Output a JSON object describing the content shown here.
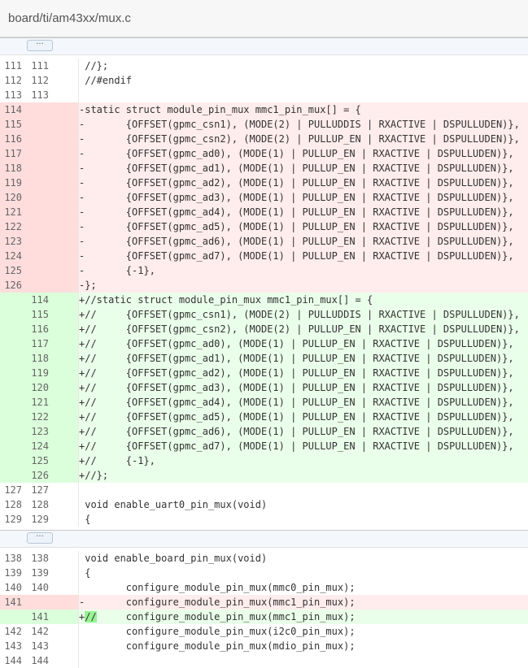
{
  "file": {
    "path": "board/ti/am43xx/mux.c"
  },
  "expander": {
    "label": "···"
  },
  "hunks": [
    [
      {
        "t": "ctx",
        "o": "111",
        "n": "111",
        "c": " //};"
      },
      {
        "t": "ctx",
        "o": "112",
        "n": "112",
        "c": " //#endif"
      },
      {
        "t": "ctx",
        "o": "113",
        "n": "113",
        "c": ""
      },
      {
        "t": "del",
        "o": "114",
        "n": "",
        "c": "-static struct module_pin_mux mmc1_pin_mux[] = {"
      },
      {
        "t": "del",
        "o": "115",
        "n": "",
        "c": "-       {OFFSET(gpmc_csn1), (MODE(2) | PULLUDDIS | RXACTIVE | DSPULLUDEN)},"
      },
      {
        "t": "del",
        "o": "116",
        "n": "",
        "c": "-       {OFFSET(gpmc_csn2), (MODE(2) | PULLUP_EN | RXACTIVE | DSPULLUDEN)},"
      },
      {
        "t": "del",
        "o": "117",
        "n": "",
        "c": "-       {OFFSET(gpmc_ad0), (MODE(1) | PULLUP_EN | RXACTIVE | DSPULLUDEN)},"
      },
      {
        "t": "del",
        "o": "118",
        "n": "",
        "c": "-       {OFFSET(gpmc_ad1), (MODE(1) | PULLUP_EN | RXACTIVE | DSPULLUDEN)},"
      },
      {
        "t": "del",
        "o": "119",
        "n": "",
        "c": "-       {OFFSET(gpmc_ad2), (MODE(1) | PULLUP_EN | RXACTIVE | DSPULLUDEN)},"
      },
      {
        "t": "del",
        "o": "120",
        "n": "",
        "c": "-       {OFFSET(gpmc_ad3), (MODE(1) | PULLUP_EN | RXACTIVE | DSPULLUDEN)},"
      },
      {
        "t": "del",
        "o": "121",
        "n": "",
        "c": "-       {OFFSET(gpmc_ad4), (MODE(1) | PULLUP_EN | RXACTIVE | DSPULLUDEN)},"
      },
      {
        "t": "del",
        "o": "122",
        "n": "",
        "c": "-       {OFFSET(gpmc_ad5), (MODE(1) | PULLUP_EN | RXACTIVE | DSPULLUDEN)},"
      },
      {
        "t": "del",
        "o": "123",
        "n": "",
        "c": "-       {OFFSET(gpmc_ad6), (MODE(1) | PULLUP_EN | RXACTIVE | DSPULLUDEN)},"
      },
      {
        "t": "del",
        "o": "124",
        "n": "",
        "c": "-       {OFFSET(gpmc_ad7), (MODE(1) | PULLUP_EN | RXACTIVE | DSPULLUDEN)},"
      },
      {
        "t": "del",
        "o": "125",
        "n": "",
        "c": "-       {-1},"
      },
      {
        "t": "del",
        "o": "126",
        "n": "",
        "c": "-};"
      },
      {
        "t": "add",
        "o": "",
        "n": "114",
        "c": "+//static struct module_pin_mux mmc1_pin_mux[] = {"
      },
      {
        "t": "add",
        "o": "",
        "n": "115",
        "c": "+//     {OFFSET(gpmc_csn1), (MODE(2) | PULLUDDIS | RXACTIVE | DSPULLUDEN)},"
      },
      {
        "t": "add",
        "o": "",
        "n": "116",
        "c": "+//     {OFFSET(gpmc_csn2), (MODE(2) | PULLUP_EN | RXACTIVE | DSPULLUDEN)},"
      },
      {
        "t": "add",
        "o": "",
        "n": "117",
        "c": "+//     {OFFSET(gpmc_ad0), (MODE(1) | PULLUP_EN | RXACTIVE | DSPULLUDEN)},"
      },
      {
        "t": "add",
        "o": "",
        "n": "118",
        "c": "+//     {OFFSET(gpmc_ad1), (MODE(1) | PULLUP_EN | RXACTIVE | DSPULLUDEN)},"
      },
      {
        "t": "add",
        "o": "",
        "n": "119",
        "c": "+//     {OFFSET(gpmc_ad2), (MODE(1) | PULLUP_EN | RXACTIVE | DSPULLUDEN)},"
      },
      {
        "t": "add",
        "o": "",
        "n": "120",
        "c": "+//     {OFFSET(gpmc_ad3), (MODE(1) | PULLUP_EN | RXACTIVE | DSPULLUDEN)},"
      },
      {
        "t": "add",
        "o": "",
        "n": "121",
        "c": "+//     {OFFSET(gpmc_ad4), (MODE(1) | PULLUP_EN | RXACTIVE | DSPULLUDEN)},"
      },
      {
        "t": "add",
        "o": "",
        "n": "122",
        "c": "+//     {OFFSET(gpmc_ad5), (MODE(1) | PULLUP_EN | RXACTIVE | DSPULLUDEN)},"
      },
      {
        "t": "add",
        "o": "",
        "n": "123",
        "c": "+//     {OFFSET(gpmc_ad6), (MODE(1) | PULLUP_EN | RXACTIVE | DSPULLUDEN)},"
      },
      {
        "t": "add",
        "o": "",
        "n": "124",
        "c": "+//     {OFFSET(gpmc_ad7), (MODE(1) | PULLUP_EN | RXACTIVE | DSPULLUDEN)},"
      },
      {
        "t": "add",
        "o": "",
        "n": "125",
        "c": "+//     {-1},"
      },
      {
        "t": "add",
        "o": "",
        "n": "126",
        "c": "+//};"
      },
      {
        "t": "ctx",
        "o": "127",
        "n": "127",
        "c": ""
      },
      {
        "t": "ctx",
        "o": "128",
        "n": "128",
        "c": " void enable_uart0_pin_mux(void)"
      },
      {
        "t": "ctx",
        "o": "129",
        "n": "129",
        "c": " {"
      }
    ],
    [
      {
        "t": "ctx",
        "o": "138",
        "n": "138",
        "c": " void enable_board_pin_mux(void)"
      },
      {
        "t": "ctx",
        "o": "139",
        "n": "139",
        "c": " {"
      },
      {
        "t": "ctx",
        "o": "140",
        "n": "140",
        "c": "        configure_module_pin_mux(mmc0_pin_mux);"
      },
      {
        "t": "del",
        "o": "141",
        "n": "",
        "c": "-       configure_module_pin_mux(mmc1_pin_mux);"
      },
      {
        "t": "add",
        "o": "",
        "n": "141",
        "c": "+//     configure_module_pin_mux(mmc1_pin_mux);",
        "hl": [
          1,
          3
        ]
      },
      {
        "t": "ctx",
        "o": "142",
        "n": "142",
        "c": "        configure_module_pin_mux(i2c0_pin_mux);"
      },
      {
        "t": "ctx",
        "o": "143",
        "n": "143",
        "c": "        configure_module_pin_mux(mdio_pin_mux);"
      },
      {
        "t": "ctx",
        "o": "144",
        "n": "144",
        "c": ""
      }
    ]
  ]
}
